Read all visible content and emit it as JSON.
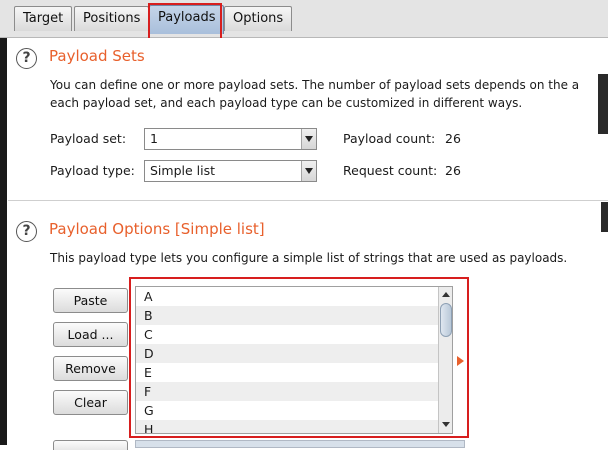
{
  "tabs": [
    {
      "label": "Target"
    },
    {
      "label": "Positions"
    },
    {
      "label": "Payloads",
      "active": true
    },
    {
      "label": "Options"
    }
  ],
  "payload_sets": {
    "title": "Payload Sets",
    "description_line1": "You can define one or more payload sets. The number of payload sets depends on the a",
    "description_line2": "each payload set, and each payload type can be customized in different ways.",
    "payload_set_label": "Payload set:",
    "payload_set_value": "1",
    "payload_type_label": "Payload type:",
    "payload_type_value": "Simple list",
    "payload_count_label": "Payload count:",
    "payload_count_value": "26",
    "request_count_label": "Request count:",
    "request_count_value": "26"
  },
  "payload_options": {
    "title": "Payload Options [Simple list]",
    "description": "This payload type lets you configure a simple list of strings that are used as payloads.",
    "buttons": {
      "paste": "Paste",
      "load": "Load ...",
      "remove": "Remove",
      "clear": "Clear"
    },
    "list_items": [
      "A",
      "B",
      "C",
      "D",
      "E",
      "F",
      "G",
      "H"
    ]
  },
  "icons": {
    "help": "?"
  },
  "colors": {
    "accent": "#e8602c",
    "highlight": "#d71e1e",
    "active_tab": "#b4c7e0"
  }
}
